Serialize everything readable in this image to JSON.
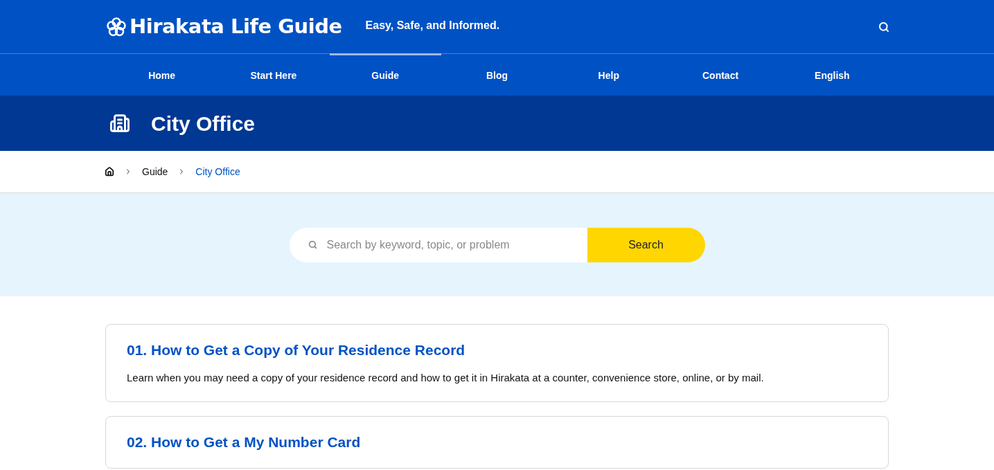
{
  "header": {
    "logo": "Hirakata Life Guide",
    "tagline": "Easy, Safe, and Informed."
  },
  "nav": [
    {
      "label": "Home",
      "selected": false
    },
    {
      "label": "Start Here",
      "selected": false
    },
    {
      "label": "Guide",
      "selected": true
    },
    {
      "label": "Blog",
      "selected": false
    },
    {
      "label": "Help",
      "selected": false
    },
    {
      "label": "Contact",
      "selected": false
    },
    {
      "label": "English",
      "selected": false
    }
  ],
  "page_title": "City Office",
  "breadcrumb": [
    "Guide",
    "City Office"
  ],
  "search": {
    "placeholder": "Search by keyword, topic, or problem",
    "button": "Search"
  },
  "articles": [
    {
      "title": "01. How to Get a Copy of Your Residence Record",
      "description": "Learn when you may need a copy of your residence record and how to get it in Hirakata at a counter, convenience store, online, or by mail."
    },
    {
      "title": "02. How to Get a My Number Card"
    }
  ]
}
